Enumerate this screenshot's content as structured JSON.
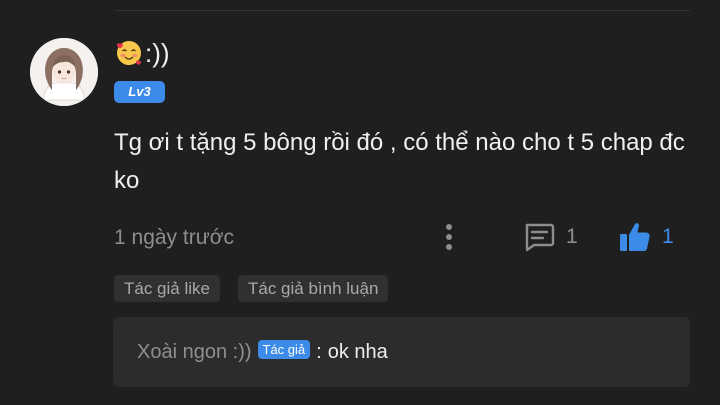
{
  "comment": {
    "username_suffix": ":))",
    "emoji": "smiling-face-with-hearts",
    "level": "Lv3",
    "text": "Tg ơi t tặng 5 bông rồi đó , có thể nào cho t 5 chap đc ko",
    "time": "1 ngày trước",
    "reply_count": "1",
    "like_count": "1"
  },
  "tags": [
    "Tác giả like",
    "Tác giả bình luận"
  ],
  "reply": {
    "author": "Xoài ngon :))",
    "badge": "Tác giả",
    "separator": ":",
    "text": "ok nha"
  },
  "colors": {
    "background": "#1f1f20",
    "accent": "#3d8be8",
    "muted_text": "#8e8e90",
    "tag_bg": "#303032",
    "reply_bg": "#2c2c2e"
  }
}
